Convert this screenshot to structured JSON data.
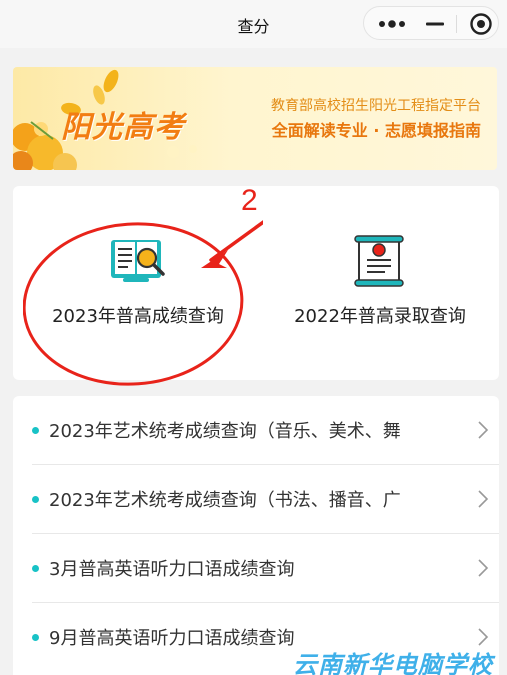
{
  "nav": {
    "title": "查分"
  },
  "banner": {
    "logo_text": "阳光高考",
    "line1": "教育部高校招生阳光工程指定平台",
    "line2": "全面解读专业 · 志愿填报指南"
  },
  "query": {
    "items": [
      {
        "label": "2023年普高成绩查询",
        "icon": "book-search-icon"
      },
      {
        "label": "2022年普高录取查询",
        "icon": "certificate-scroll-icon"
      }
    ],
    "annotation_number": "2"
  },
  "list": {
    "items": [
      {
        "label": "2023年艺术统考成绩查询（音乐、美术、舞"
      },
      {
        "label": "2023年艺术统考成绩查询（书法、播音、广"
      },
      {
        "label": "3月普高英语听力口语成绩查询"
      },
      {
        "label": "9月普高英语听力口语成绩查询"
      }
    ]
  },
  "watermark": "云南新华电脑学校",
  "colors": {
    "accent": "#18c2c6",
    "annotation": "#e8231a",
    "banner_orange": "#f27d12",
    "watermark": "#3fb0e9"
  }
}
